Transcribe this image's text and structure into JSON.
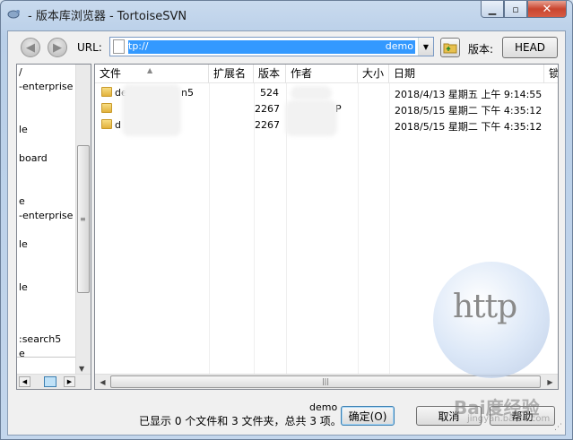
{
  "window": {
    "title": "- 版本库浏览器 - TortoiseSVN",
    "minimize_glyph": "▁",
    "maximize_glyph": "▫",
    "close_glyph": "✕"
  },
  "toolbar": {
    "back_glyph": "◀",
    "forward_glyph": "▶",
    "url_label": "URL:",
    "url_value_start": "tp://",
    "url_value_end": "demo",
    "revision_label": "版本:",
    "revision_button": "HEAD"
  },
  "tree": {
    "items": [
      "/",
      "-enterprise",
      "le",
      "board",
      "e",
      "-enterprise",
      "le",
      "le",
      ":search5",
      "e"
    ]
  },
  "list": {
    "columns": [
      "文件",
      "扩展名",
      "版本",
      "作者",
      "大小",
      "日期",
      "锁"
    ],
    "rows": [
      {
        "name_start": "de",
        "name_end": "n5",
        "revision": "524",
        "date": "2018/4/13 星期五 上午 9:14:55"
      },
      {
        "name_start": "",
        "name_end": "e",
        "revision": "2267",
        "author_start": "",
        "author_end": "P",
        "date": "2018/5/15 星期二 下午 4:35:12"
      },
      {
        "name_start": "d",
        "name_end": "",
        "revision": "2267",
        "author_start": "h",
        "author_end": "",
        "date": "2018/5/15 星期二 下午 4:35:12"
      }
    ],
    "scroll_grip": "|||"
  },
  "watermark": {
    "text": "http",
    "brand": "Bai度经验",
    "brand_sub": "jingyan.baidu.com"
  },
  "footer": {
    "path": "demo",
    "status": "已显示 0 个文件和 3 文件夹，总共 3 项。",
    "ok_button": "确定(O)",
    "cancel_button": "取消",
    "help_button": "帮助"
  }
}
